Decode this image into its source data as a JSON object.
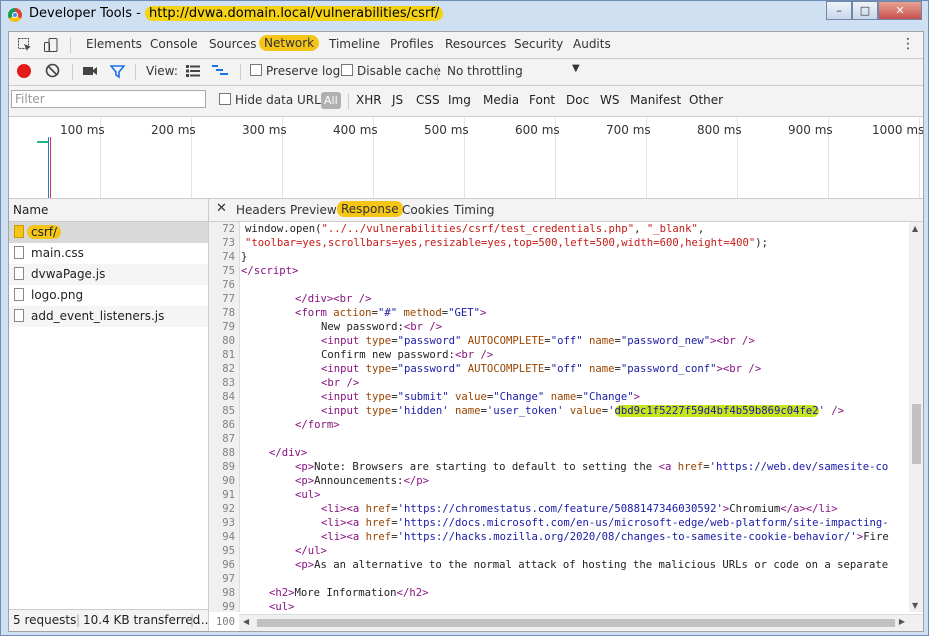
{
  "window": {
    "app_title": "Developer Tools",
    "url": "http://dvwa.domain.local/vulnerabilities/csrf/"
  },
  "tabs": [
    "Elements",
    "Console",
    "Sources",
    "Network",
    "Timeline",
    "Profiles",
    "Resources",
    "Security",
    "Audits"
  ],
  "active_tab": "Network",
  "toolbar": {
    "view_label": "View:",
    "preserve_log": "Preserve log",
    "disable_cache": "Disable cache",
    "throttling": "No throttling"
  },
  "filter": {
    "placeholder": "Filter",
    "hide_data_urls": "Hide data URLs",
    "all_label": "All",
    "types": [
      "XHR",
      "JS",
      "CSS",
      "Img",
      "Media",
      "Font",
      "Doc",
      "WS",
      "Manifest",
      "Other"
    ]
  },
  "timeline": {
    "ticks": [
      "100 ms",
      "200 ms",
      "300 ms",
      "400 ms",
      "500 ms",
      "600 ms",
      "700 ms",
      "800 ms",
      "900 ms",
      "1000 ms"
    ]
  },
  "requests": {
    "header": "Name",
    "files": [
      "csrf/",
      "main.css",
      "dvwaPage.js",
      "logo.png",
      "add_event_listeners.js"
    ],
    "status": "5 requests",
    "transferred": "10.4 KB transferred",
    "more": "..."
  },
  "detail_tabs": [
    "Headers",
    "Preview",
    "Response",
    "Cookies",
    "Timing"
  ],
  "active_detail_tab": "Response",
  "response": {
    "line_numbers": [
      "72",
      "73",
      "74",
      "75",
      "76",
      "77",
      "78",
      "79",
      "80",
      "81",
      "82",
      "83",
      "84",
      "85",
      "86",
      "87",
      "88",
      "89",
      "90",
      "91",
      "92",
      "93",
      "94",
      "95",
      "96",
      "97",
      "98",
      "99",
      "100"
    ],
    "user_token": "dbd9c1f5227f59d4bf4b59b869c04fe2"
  },
  "colors": {
    "highlight": "#f5c518",
    "token_highlight": "#c7e51c"
  }
}
